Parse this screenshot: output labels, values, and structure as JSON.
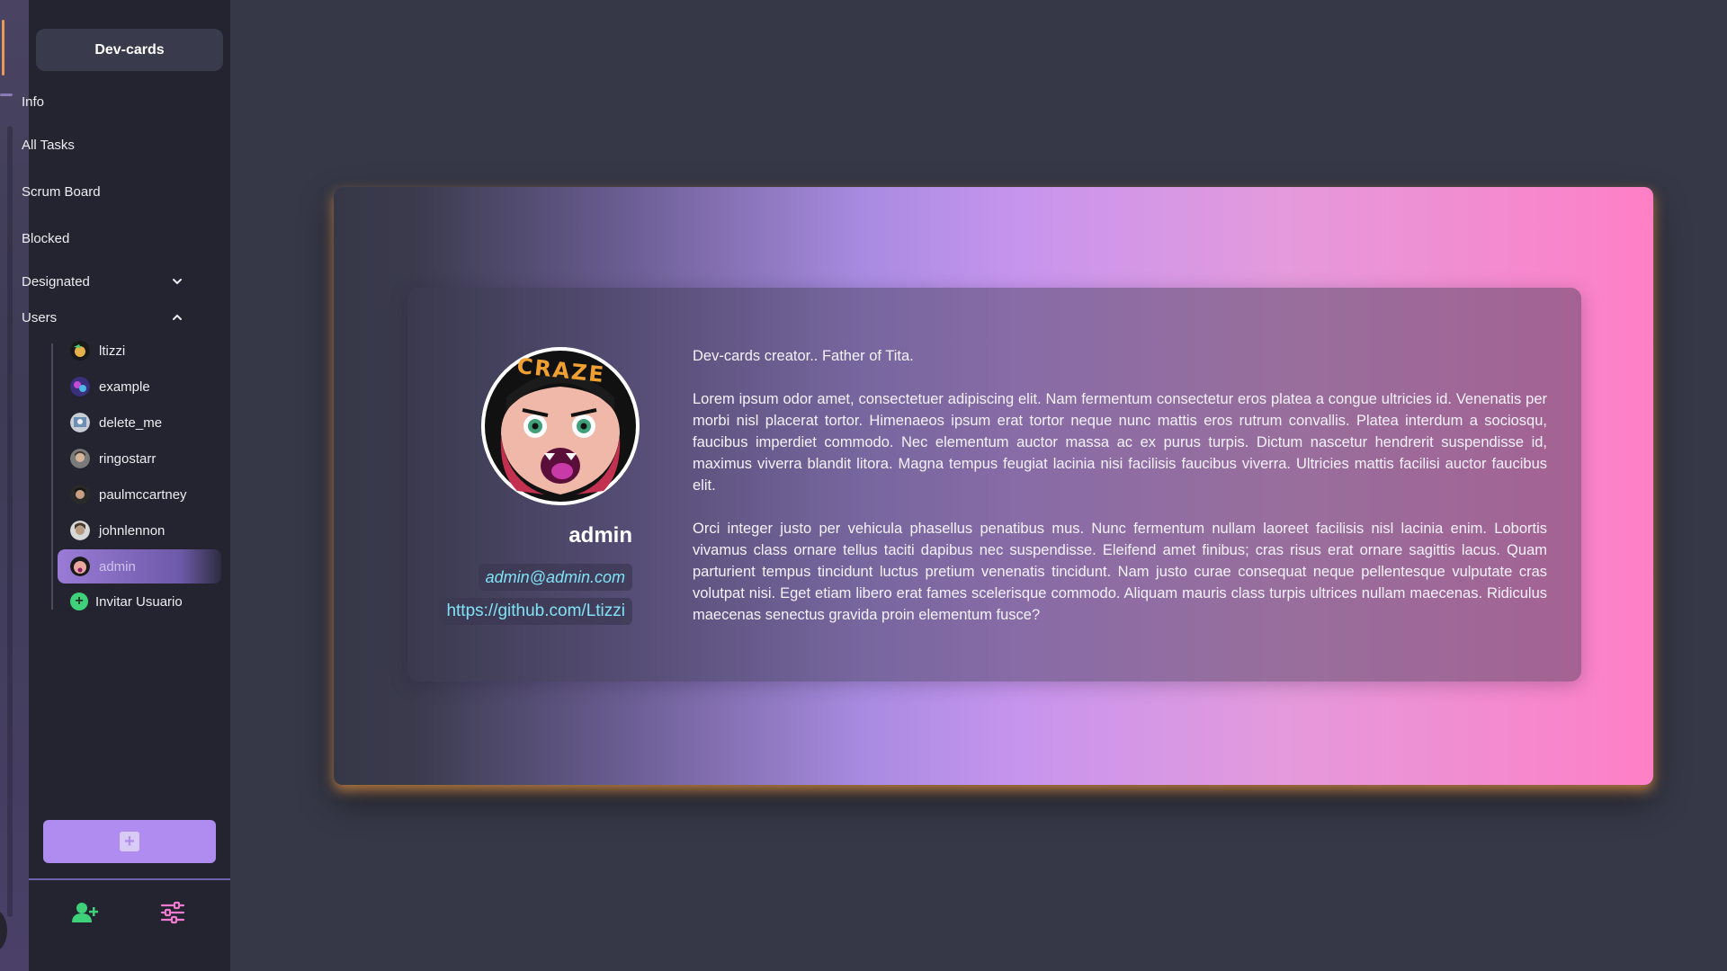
{
  "sidebar": {
    "brand": "Dev-cards",
    "nav": {
      "info": "Info",
      "all_tasks": "All Tasks",
      "scrum_board": "Scrum Board",
      "blocked": "Blocked",
      "designated": "Designated",
      "users": "Users"
    },
    "users": [
      {
        "name": "ltizzi"
      },
      {
        "name": "example"
      },
      {
        "name": "delete_me"
      },
      {
        "name": "ringostarr"
      },
      {
        "name": "paulmccartney"
      },
      {
        "name": "johnlennon"
      },
      {
        "name": "admin",
        "active": true
      }
    ],
    "invite_label": "Invitar Usuario",
    "add_icon": "plus-square-icon",
    "footer_icons": [
      "add-user-icon",
      "settings-sliders-icon"
    ]
  },
  "profile": {
    "avatar_text": "CRAZE",
    "username": "admin",
    "email": "admin@admin.com",
    "github": "https://github.com/Ltizzi",
    "bio": [
      "Dev-cards creator.. Father of Tita.",
      "Lorem ipsum odor amet, consectetuer adipiscing elit. Nam fermentum consectetur eros platea a congue ultricies id. Venenatis per morbi nisl placerat tortor. Himenaeos ipsum erat tortor neque nunc mattis eros rutrum convallis. Platea interdum a sociosqu, faucibus imperdiet commodo. Nec elementum auctor massa ac ex purus turpis. Dictum nascetur hendrerit suspendisse id, maximus viverra blandit litora. Magna tempus feugiat lacinia nisi facilisis faucibus viverra. Ultricies mattis facilisi auctor faucibus elit.",
      "Orci integer justo per vehicula phasellus penatibus mus. Nunc fermentum nullam laoreet facilisis nisl lacinia enim. Lobortis vivamus class ornare tellus taciti dapibus nec suspendisse. Eleifend amet finibus; cras risus erat ornare sagittis lacus. Quam parturient tempus tincidunt luctus pretium venenatis tincidunt. Nam justo curae consequat neque pellentesque vulputate cras volutpat nisi. Eget etiam libero erat fames scelerisque commodo. Aliquam mauris class turpis ultrices nullam maecenas. Ridiculus maecenas senectus gravida proin elementum fusce?"
    ]
  },
  "colors": {
    "background": "#363847",
    "sidebar": "#232430",
    "accent_purple": "#b08cf0",
    "accent_pink": "#ff7fc6",
    "link_cyan": "#7fe3f5",
    "invite_green": "#3fd07a"
  }
}
